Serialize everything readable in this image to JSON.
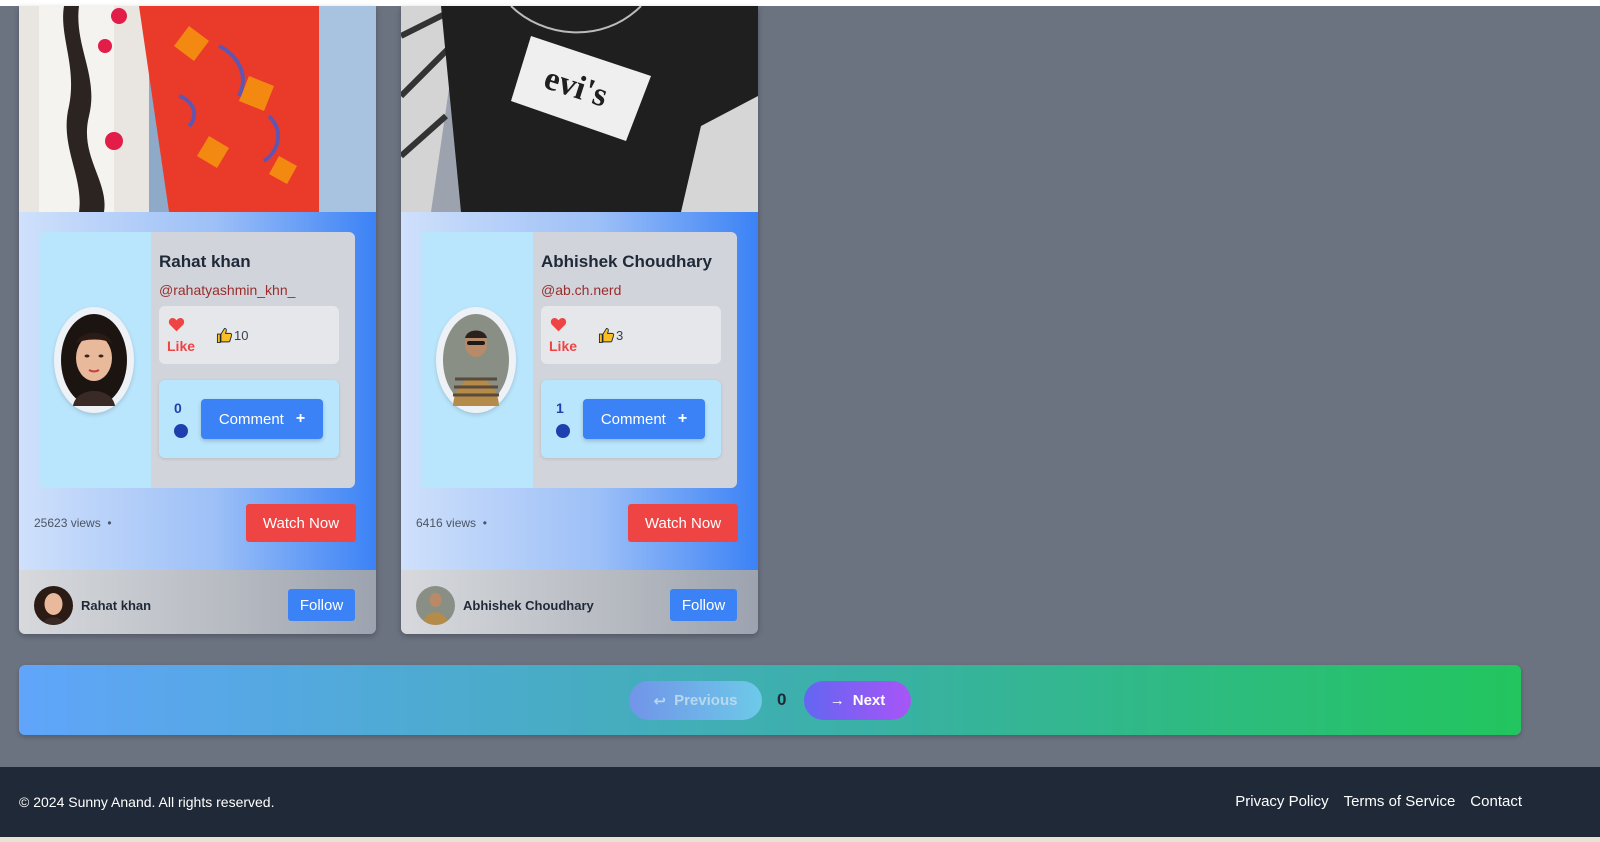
{
  "posts": [
    {
      "user_name": "Rahat khan",
      "handle": "@rahatyashmin_khn_",
      "like_label": "Like",
      "like_count": "10",
      "comment_count": "0",
      "comment_label": "Comment",
      "views": "25623 views",
      "watch_label": "Watch Now",
      "footer_name": "Rahat khan",
      "follow_label": "Follow"
    },
    {
      "user_name": "Abhishek Choudhary",
      "handle": "@ab.ch.nerd",
      "like_label": "Like",
      "like_count": "3",
      "comment_count": "1",
      "comment_label": "Comment",
      "views": "6416 views",
      "watch_label": "Watch Now",
      "footer_name": "Abhishek Choudhary",
      "follow_label": "Follow"
    }
  ],
  "pagination": {
    "previous_label": "Previous",
    "current_page": "0",
    "next_label": "Next"
  },
  "footer": {
    "copyright": "© 2024 Sunny Anand. All rights reserved.",
    "links": [
      "Privacy Policy",
      "Terms of Service",
      "Contact"
    ]
  },
  "icons": {
    "like": "heart-icon",
    "count": "thumbs-up-icon",
    "comment_add": "plus-icon",
    "previous": "arrow-left-icon",
    "next": "arrow-right-icon"
  },
  "colors": {
    "page_bg": "#6b7280",
    "primary_button": "#3b82f6",
    "watch_button": "#ef4444",
    "footer_bg": "#1f2937"
  }
}
